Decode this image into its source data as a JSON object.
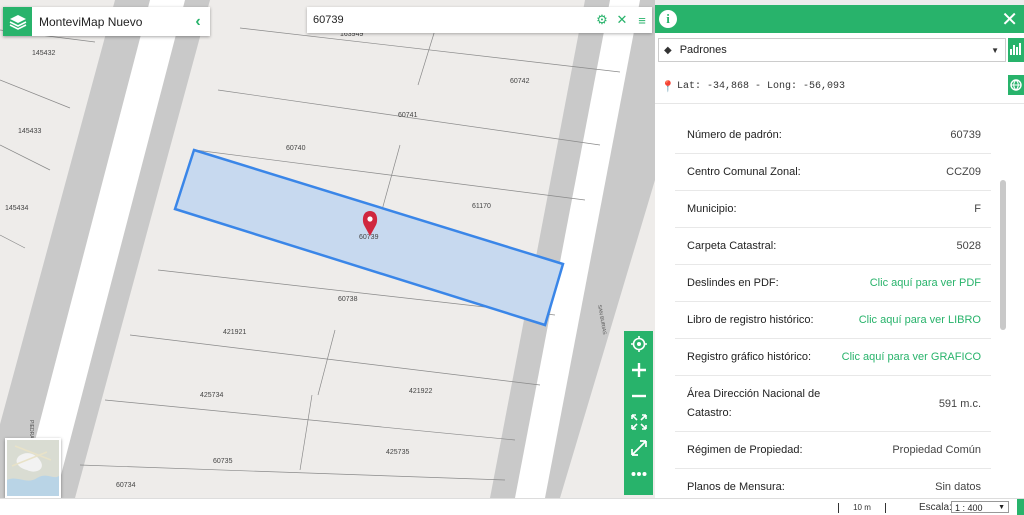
{
  "app": {
    "title": "MonteviMap Nuevo"
  },
  "search": {
    "value": "60739"
  },
  "map": {
    "selected_parcel": "60739",
    "parcel_labels": [
      "145432",
      "145433",
      "145434",
      "163949",
      "60742",
      "60741",
      "60740",
      "61170",
      "60739",
      "60738",
      "421921",
      "421922",
      "425734",
      "425735",
      "60735",
      "60734"
    ],
    "street_labels": [
      "SAN BURIAS",
      "PIEDRA"
    ]
  },
  "panel": {
    "layer": "Padrones",
    "coords": "Lat: -34,868 - Long: -56,093",
    "attributes": [
      {
        "label": "Número de padrón:",
        "value": "60739",
        "link": false
      },
      {
        "label": "Centro Comunal Zonal:",
        "value": "CCZ09",
        "link": false
      },
      {
        "label": "Municipio:",
        "value": "F",
        "link": false
      },
      {
        "label": "Carpeta Catastral:",
        "value": "5028",
        "link": false
      },
      {
        "label": "Deslindes en PDF:",
        "value": "Clic aquí para ver PDF",
        "link": true
      },
      {
        "label": "Libro de registro histórico:",
        "value": "Clic aquí para ver LIBRO",
        "link": true
      },
      {
        "label": "Registro gráfico histórico:",
        "value": "Clic aquí para ver GRAFICO",
        "link": true
      },
      {
        "label": "Área Dirección Nacional de Catastro:",
        "value": "591 m.c.",
        "link": false
      },
      {
        "label": "Régimen de Propiedad:",
        "value": "Propiedad Común",
        "link": false
      },
      {
        "label": "Planos de Mensura:",
        "value": "Sin datos",
        "link": false
      }
    ]
  },
  "scale": {
    "distance": "10 m",
    "label": "Escala:",
    "value": "1 : 400"
  },
  "colors": {
    "accent": "#28b36b",
    "selection": "#3a86e8"
  },
  "icons": [
    "layers-icon",
    "chevron-left-icon",
    "gear-icon",
    "close-icon",
    "menu-icon",
    "locate-icon",
    "zoom-in-icon",
    "zoom-out-icon",
    "fit-icon",
    "fullscreen-icon",
    "more-icon",
    "info-icon",
    "map-pin-icon",
    "chart-icon",
    "globe-icon"
  ]
}
